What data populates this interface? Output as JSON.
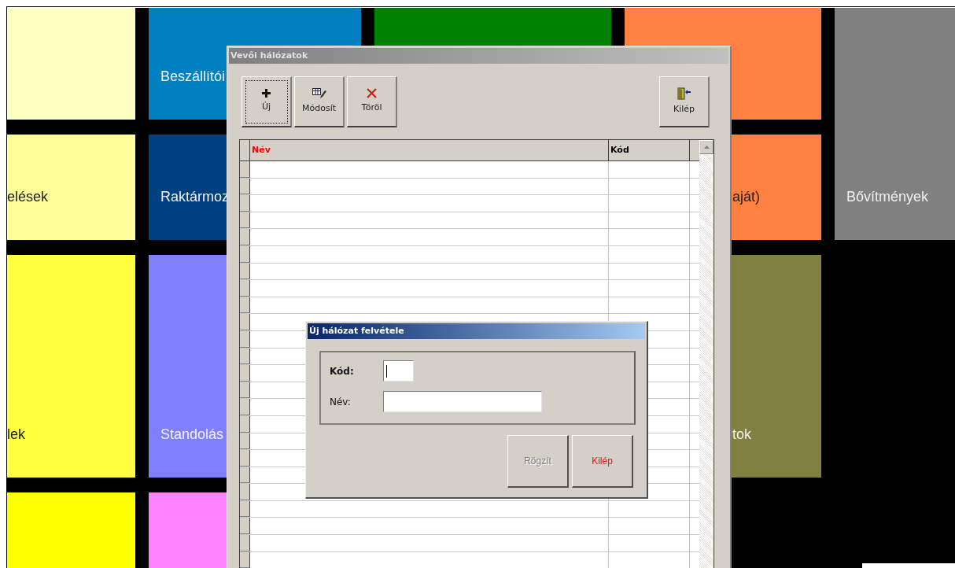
{
  "tiles": [
    {
      "color": "#ffffc0"
    },
    {
      "color": "#0080c0",
      "label": "Beszállítói"
    },
    {
      "color": "#008000"
    },
    {
      "color": "#ff8040"
    },
    {
      "color": "#ffff99",
      "label": "elések"
    },
    {
      "color": "#004080",
      "label": "Raktármoz"
    },
    {
      "color": "#ff8040",
      "label": "aját)"
    },
    {
      "color": "#808080",
      "label": "Bővítmények"
    },
    {
      "color": "#ffff40",
      "label": "lek"
    },
    {
      "color": "#8080ff",
      "label": "Standolás"
    },
    {
      "color": "#808040",
      "label": "tok"
    },
    {
      "color": "#ffff00"
    },
    {
      "color": "#ff80ff"
    }
  ],
  "window": {
    "title": "Vevői hálózatok",
    "toolbar": [
      {
        "kind": "new",
        "label": "Új",
        "focused": true
      },
      {
        "kind": "edit",
        "label": "Módosít",
        "focused": false
      },
      {
        "kind": "delete",
        "label": "Töröl",
        "focused": false
      },
      {
        "kind": "exit",
        "label": "Kilép",
        "focused": false
      }
    ],
    "table": {
      "columns": [
        {
          "label": "Név",
          "color": "#ff0000"
        },
        {
          "label": "Kód",
          "color": "#000000"
        }
      ]
    }
  },
  "dialog": {
    "title": "Új hálózat felvétele",
    "fields": [
      {
        "label": "Kód:",
        "focused": true
      },
      {
        "label": "Név:",
        "focused": false
      }
    ],
    "buttons": [
      {
        "label": "Rögzít",
        "disabled": true,
        "color": "#808080"
      },
      {
        "label": "Kilép",
        "disabled": false,
        "color": "#e01818"
      }
    ]
  }
}
